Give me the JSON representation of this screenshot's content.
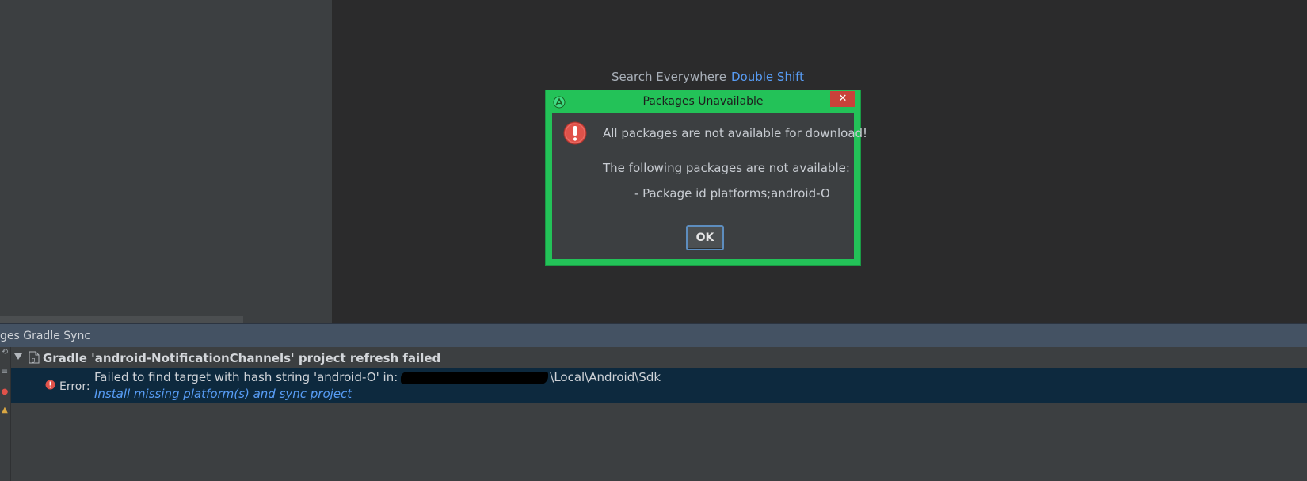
{
  "editor": {
    "hint_label": "Search Everywhere",
    "hint_shortcut": "Double Shift"
  },
  "dialog": {
    "title": "Packages Unavailable",
    "close_label": "✕",
    "main_message": "All packages are not available for download!",
    "sub_message": "The following packages are not available:",
    "package_line": "- Package id platforms;android-O",
    "ok_label": "OK",
    "icons": {
      "app": "android-studio-icon",
      "error": "error-icon"
    }
  },
  "tool_window": {
    "title": "ges Gradle Sync",
    "header_row": "Gradle 'android-NotificationChannels' project refresh failed",
    "error_label": "Error:",
    "error_message_start": "Failed to find target with hash string 'android-O' in:",
    "error_message_end": "\\Local\\Android\\Sdk",
    "link": "Install missing platform(s) and sync project"
  },
  "colors": {
    "dialog_frame": "#23c258",
    "link": "#589df6",
    "selection": "#0d293e",
    "error_red": "#e0524a"
  }
}
